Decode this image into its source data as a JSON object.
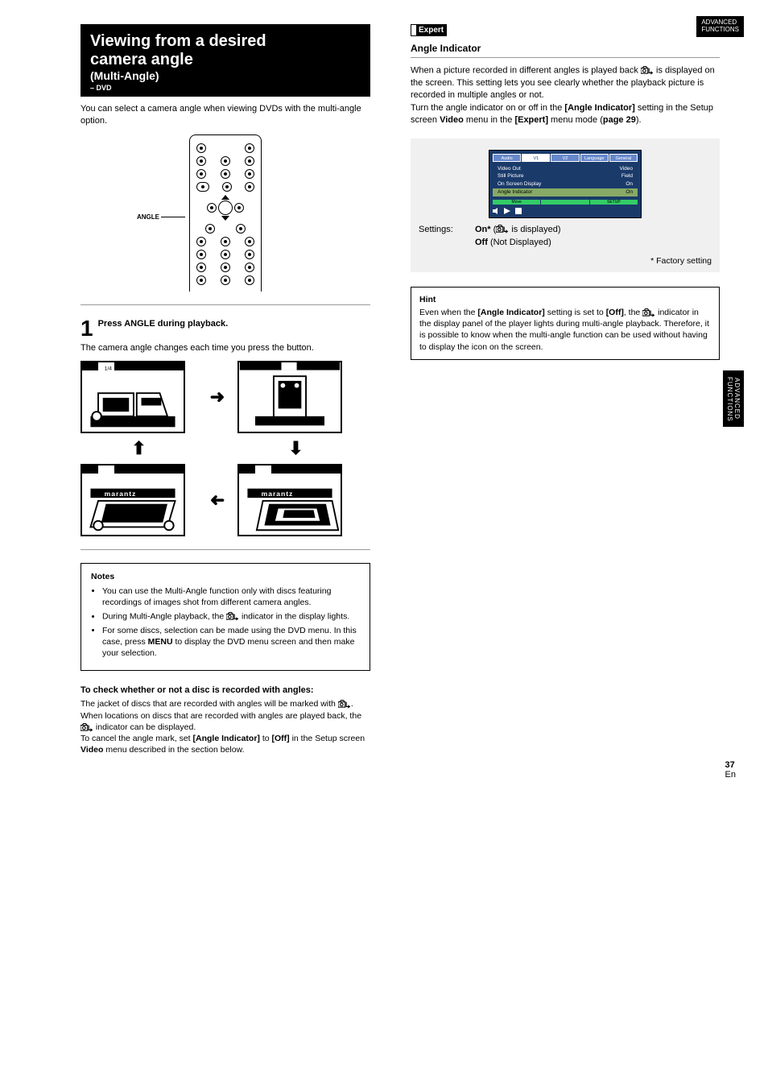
{
  "page": {
    "topbar_line1": "ADVANCED",
    "topbar_line2": "FUNCTIONS",
    "sidebar_text": "ADVANCED FUNCTIONS",
    "page_number_label": "En",
    "page_number": "37"
  },
  "title": {
    "main_line1": "Viewing from a desired",
    "main_line2": "camera angle",
    "sub": "(Multi-Angle)",
    "dvd": "– DVD"
  },
  "intro": "You can select a camera angle when viewing DVDs with the multi-angle option.",
  "remote": {
    "angle_label": "ANGLE"
  },
  "step": {
    "num": "1",
    "title": "Press ANGLE during playback.",
    "sub": "The camera angle changes each time you press the button."
  },
  "scenes": {
    "icon_label": "1/4",
    "brand": "marantz"
  },
  "notes": {
    "heading": "Notes",
    "i1": "You can use the Multi-Angle function only with discs featuring recordings of images shot from different camera angles.",
    "i2a": "During Multi-Angle playback, the ",
    "i2b": " indicator in the display lights.",
    "i3a": "For some discs, selection can be made using the DVD menu. In this case, press ",
    "i3b": "MENU",
    "i3c": " to display the DVD menu screen and then make your selection."
  },
  "check": {
    "heading": "To check whether or not a disc is recorded with angles:",
    "p1a": "The jacket of discs that are recorded with angles will be marked with ",
    "p1b": ". When locations on discs that are recorded with angles are played back, the ",
    "p1c": " indicator can be displayed.",
    "p2a": "To cancel the angle mark, set ",
    "p2b": "[Angle Indicator]",
    "p2c": " to ",
    "p2d": "[Off]",
    "p2e": " in the Setup screen ",
    "p2f": "Video",
    "p2g": " menu described in the section below."
  },
  "right": {
    "expert_label": "Expert",
    "heading": "Angle Indicator",
    "p1": "When a picture recorded in different angles is played back ",
    "p1b": " is displayed on the screen. This setting lets you see clearly whether the playback picture is recorded in multiple angles or not.",
    "p2a": "Turn the angle indicator on or off in the ",
    "p2b": "[Angle Indicator]",
    "p2c": " setting in the Setup screen ",
    "p2d": "Video",
    "p2e": " menu in the ",
    "p2f": "[Expert]",
    "p2g": " menu mode (",
    "p2h": "page 29",
    "p2i": ").",
    "settings_label": "Settings:",
    "opt1_bold": "On*",
    "opt1_paren": " is displayed)",
    "opt1_open": " (",
    "opt2_bold": "Off",
    "opt2_paren": " (Not Displayed)",
    "factory": "* Factory setting"
  },
  "setup_screen": {
    "tab1": "Audio",
    "tab2": "V1",
    "tab3": "V2",
    "tab4": "Language",
    "tab5": "General",
    "r1k": "Video Out",
    "r1v": "Video",
    "r2k": "Still Picture",
    "r2v": "Field",
    "r3k": "On Screen Display",
    "r3v": "On",
    "r4k": "Angle Indicator",
    "r4v": "On",
    "g1": "Move",
    "g2": "",
    "g3": "SETUP"
  },
  "hint": {
    "heading": "Hint",
    "t1": "Even when the ",
    "t2": "[Angle Indicator]",
    "t3": " setting is set to ",
    "t4": "[Off]",
    "t5": ", the ",
    "t6": " indicator in the display panel of the player lights during multi-angle playback. Therefore, it is possible to know when the multi-angle function can be used without having to display the icon on the screen."
  }
}
